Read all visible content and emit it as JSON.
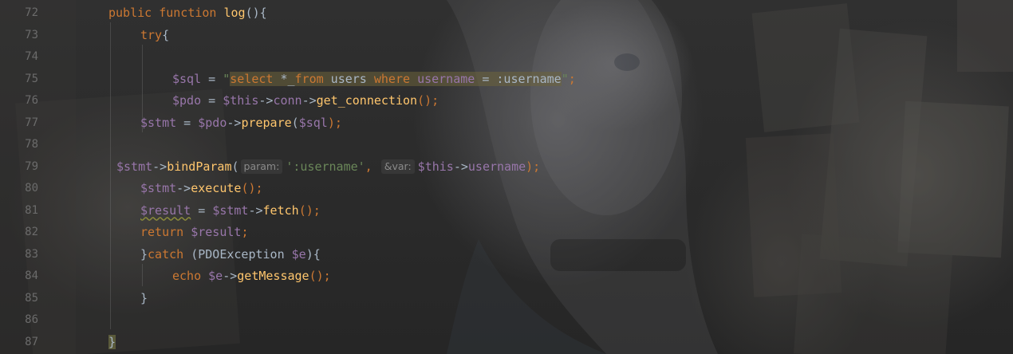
{
  "editor": {
    "line_numbers": [
      "72",
      "73",
      "74",
      "75",
      "76",
      "77",
      "78",
      "79",
      "80",
      "81",
      "82",
      "83",
      "84",
      "85",
      "86",
      "87"
    ],
    "l72": {
      "kw1": "public",
      "kw2": "function",
      "fn": "log",
      "rest": "(){"
    },
    "l73": {
      "kw": "try",
      "rest": "{"
    },
    "l75": {
      "var": "$sql",
      "eq": " = ",
      "q_open": "\"",
      "s1": "select",
      "s2": " *_",
      "s3": "from",
      "s4": " users ",
      "s5": "where",
      "s6": " ",
      "s7": "username",
      "s8": " = :username",
      "q_close": "\"",
      "semi": ";"
    },
    "l76": {
      "var": "$pdo",
      "eq": " = ",
      "this": "$this",
      "arrow1": "->",
      "prop": "conn",
      "arrow2": "->",
      "fn": "get_connection",
      "rest": "();"
    },
    "l77": {
      "var": "$stmt",
      "eq": " = ",
      "var2": "$pdo",
      "arrow": "->",
      "fn": "prepare",
      "open": "(",
      "arg": "$sql",
      "close": ");"
    },
    "l79": {
      "var": "$stmt",
      "arrow": "->",
      "fn": "bindParam",
      "open": "(",
      "hint1": "param:",
      "str": "':username'",
      "comma": ",",
      "hint2": "&var:",
      "this": "$this",
      "arrow2": "->",
      "prop": "username",
      "close": ");"
    },
    "l80": {
      "var": "$stmt",
      "arrow": "->",
      "fn": "execute",
      "rest": "();"
    },
    "l81": {
      "var": "$result",
      "eq": " = ",
      "var2": "$stmt",
      "arrow": "->",
      "fn": "fetch",
      "rest": "();"
    },
    "l82": {
      "kw": "return",
      "var": " $result",
      "semi": ";"
    },
    "l83": {
      "brace": "}",
      "kw": "catch",
      "open": " (",
      "cls": "PDOException",
      "var": " $e",
      "rest": "){"
    },
    "l84": {
      "kw": "echo",
      "var": " $e",
      "arrow": "->",
      "fn": "getMessage",
      "rest": "();"
    },
    "l85": {
      "brace": "}"
    },
    "l87": {
      "brace": "}"
    }
  },
  "colors": {
    "keyword": "#cc7832",
    "function": "#ffc66d",
    "variable": "#9876aa",
    "string": "#6a8759",
    "plain": "#a9b7c6",
    "line_number": "#6b6b6b"
  }
}
